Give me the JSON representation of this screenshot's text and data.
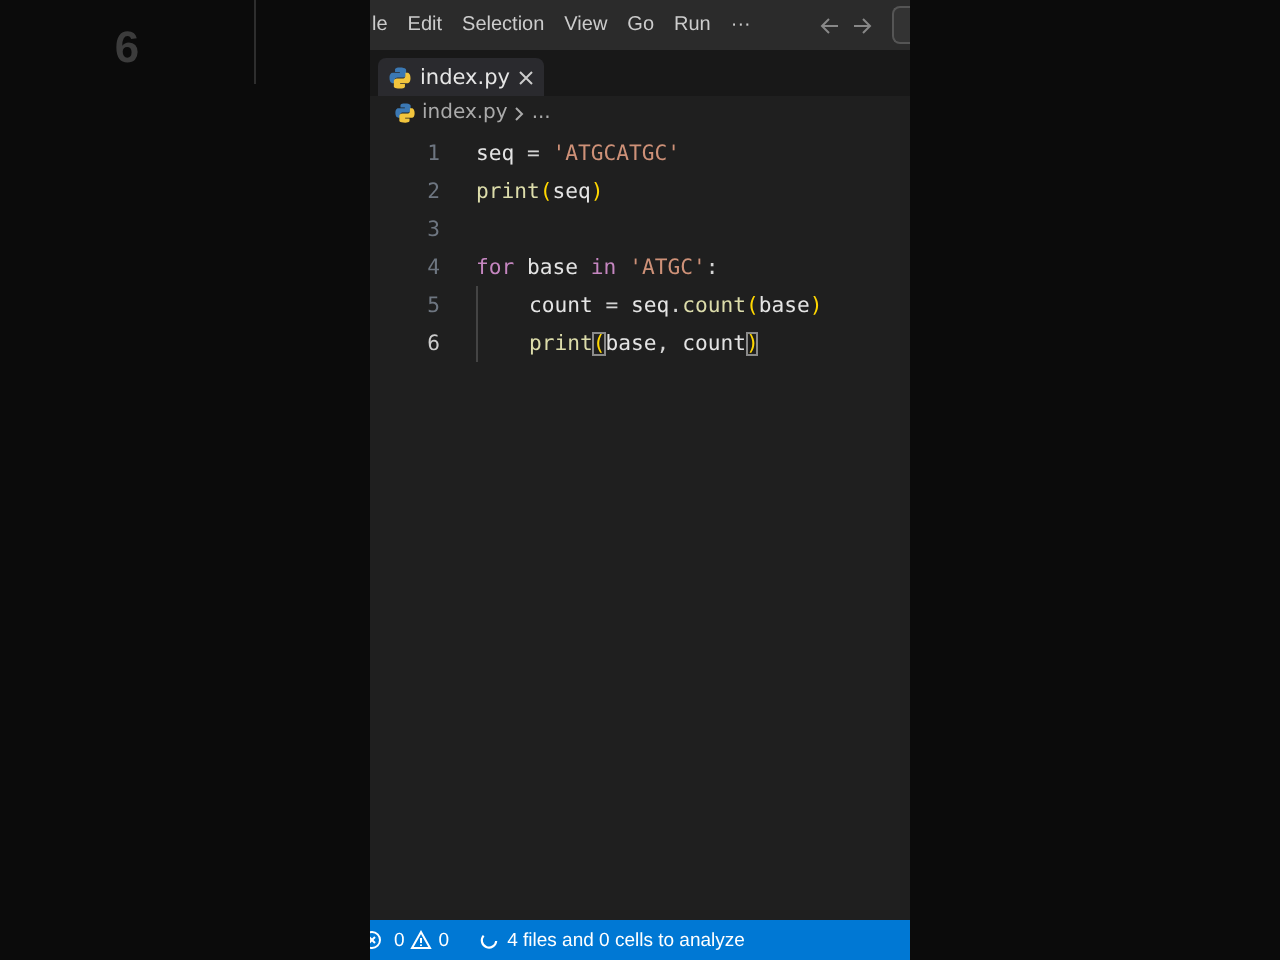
{
  "backdrop": {
    "number": "6"
  },
  "menu_bar": {
    "items": [
      "le",
      "Edit",
      "Selection",
      "View",
      "Go",
      "Run",
      "···"
    ]
  },
  "tabs": [
    {
      "label": "index.py",
      "selected": true
    }
  ],
  "breadcrumb": {
    "file": "index.py",
    "rest": "..."
  },
  "code": {
    "lines": [
      {
        "number": "1",
        "active": false,
        "tokens": [
          {
            "kind": "var",
            "text": "seq"
          },
          {
            "kind": "op",
            "text": " = "
          },
          {
            "kind": "string",
            "text": "'ATGCATGC'"
          }
        ]
      },
      {
        "number": "2",
        "active": false,
        "tokens": [
          {
            "kind": "func",
            "text": "print"
          },
          {
            "kind": "bracket",
            "text": "("
          },
          {
            "kind": "var",
            "text": "seq"
          },
          {
            "kind": "bracket",
            "text": ")"
          }
        ]
      },
      {
        "number": "3",
        "active": false
      },
      {
        "number": "4",
        "active": false,
        "tokens": [
          {
            "kind": "keyword",
            "text": "for"
          },
          {
            "kind": "var",
            "text": " base "
          },
          {
            "kind": "keyword",
            "text": "in"
          },
          {
            "kind": "string",
            "text": " 'ATGC'"
          },
          {
            "kind": "op",
            "text": ":"
          }
        ]
      },
      {
        "number": "5",
        "active": false,
        "indented": true,
        "tokens": [
          {
            "kind": "var",
            "text": "count"
          },
          {
            "kind": "op",
            "text": " = "
          },
          {
            "kind": "var",
            "text": "seq"
          },
          {
            "kind": "op",
            "text": "."
          },
          {
            "kind": "func",
            "text": "count"
          },
          {
            "kind": "bracket",
            "text": "("
          },
          {
            "kind": "var",
            "text": "base"
          },
          {
            "kind": "bracket",
            "text": ")"
          }
        ]
      },
      {
        "number": "6",
        "active": true,
        "indented": true,
        "tokens": [
          {
            "kind": "func",
            "text": "print"
          },
          {
            "kind": "matched",
            "text": "("
          },
          {
            "kind": "var",
            "text": "base"
          },
          {
            "kind": "op",
            "text": ", "
          },
          {
            "kind": "var",
            "text": "count"
          },
          {
            "kind": "matched",
            "text": ")"
          }
        ]
      }
    ]
  },
  "status_bar": {
    "errors": "0",
    "warnings": "0",
    "message": "4 files and 0 cells to analyze"
  }
}
